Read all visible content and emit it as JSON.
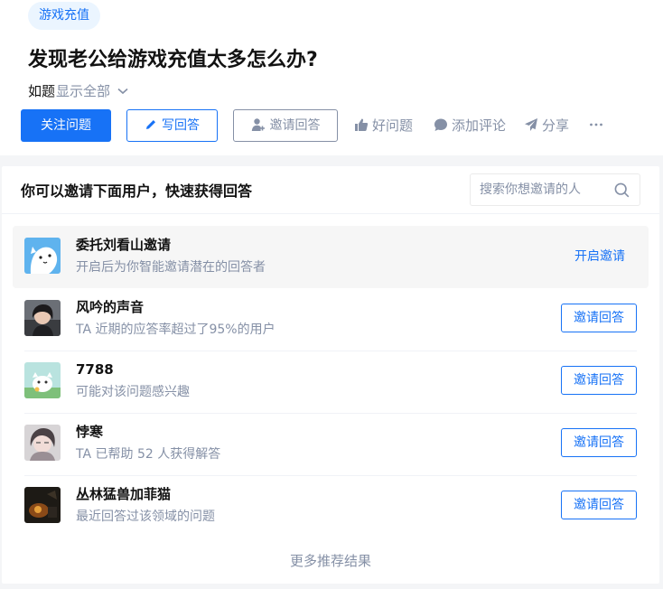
{
  "question": {
    "topic": "游戏充值",
    "title": "发现老公给游戏充值太多怎么办?",
    "detail": "如题",
    "show_all": "显示全部"
  },
  "actions": {
    "follow": "关注问题",
    "write": "写回答",
    "invite": "邀请回答",
    "good_question": "好问题",
    "comment": "添加评论",
    "share": "分享"
  },
  "invite_panel": {
    "title": "你可以邀请下面用户，快速获得回答",
    "search_placeholder": "搜索你想邀请的人",
    "more": "更多推荐结果",
    "users": [
      {
        "name": "委托刘看山邀请",
        "desc": "开启后为你智能邀请潜在的回答者",
        "action": "开启邀请"
      },
      {
        "name": "风吟的声音",
        "desc": "TA 近期的应答率超过了95%的用户",
        "action": "邀请回答"
      },
      {
        "name": "7788",
        "desc": "可能对该问题感兴趣",
        "action": "邀请回答"
      },
      {
        "name": "悖寒",
        "desc": "TA 已帮助 52 人获得解答",
        "action": "邀请回答"
      },
      {
        "name": "丛林猛兽加菲猫",
        "desc": "最近回答过该领域的问题",
        "action": "邀请回答"
      }
    ]
  },
  "colors": {
    "primary": "#1772f6",
    "muted": "#8590a6",
    "text": "#121212"
  }
}
